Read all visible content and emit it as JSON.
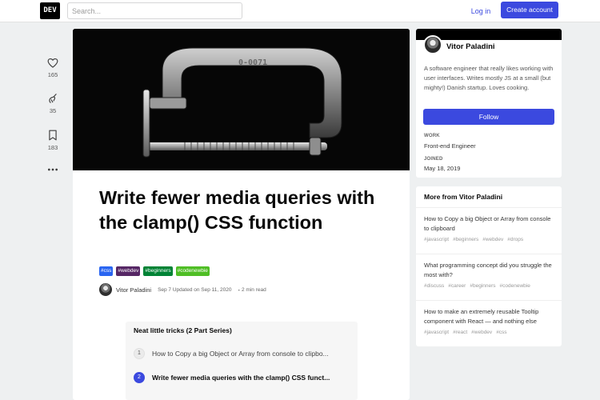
{
  "header": {
    "logo_text": "DEV",
    "search_placeholder": "Search...",
    "login_label": "Log in",
    "create_account_label": "Create account"
  },
  "reactions": [
    {
      "icon": "heart-icon",
      "count": "165"
    },
    {
      "icon": "unicorn-icon",
      "count": "35"
    },
    {
      "icon": "bookmark-icon",
      "count": "183"
    },
    {
      "icon": "more-options-icon",
      "count": ""
    }
  ],
  "article": {
    "cover_text": "0-0071",
    "title": "Write fewer media queries with the clamp() CSS function",
    "tags": [
      {
        "label": "#css",
        "color": "#2965f1"
      },
      {
        "label": "#webdev",
        "color": "#562765"
      },
      {
        "label": "#beginners",
        "color": "#008335"
      },
      {
        "label": "#codenewbie",
        "color": "#4fbe25"
      }
    ],
    "author": "Vitor Paladini",
    "date": "Sep 7 Updated on Sep 11, 2020",
    "separator": "・",
    "read_time": "2 min read"
  },
  "series": {
    "title": "Neat little tricks (2 Part Series)",
    "items": [
      {
        "num": "1",
        "label": "How to Copy a big Object or Array from console to clipbo..."
      },
      {
        "num": "2",
        "label": "Write fewer media queries with the clamp() CSS funct..."
      }
    ]
  },
  "profile": {
    "name": "Vitor Paladini",
    "bio": "A software engineer that really likes working with user interfaces. Writes mostly JS at a small (but mighty!) Danish startup. Loves cooking.",
    "follow_label": "Follow",
    "work_label": "WORK",
    "work_value": "Front-end Engineer",
    "joined_label": "JOINED",
    "joined_value": "May 18, 2019"
  },
  "more": {
    "heading": "More from Vitor Paladini",
    "items": [
      {
        "title": "How to Copy a big Object or Array from console to clipboard",
        "tags": [
          "#javascript",
          "#beginners",
          "#webdev",
          "#drops"
        ]
      },
      {
        "title": "What programming concept did you struggle the most with?",
        "tags": [
          "#discuss",
          "#career",
          "#beginners",
          "#codenewbie"
        ]
      },
      {
        "title": "How to make an extremely reusable Tooltip component with React — and nothing else",
        "tags": [
          "#javascript",
          "#react",
          "#webdev",
          "#css"
        ]
      }
    ]
  },
  "colors": {
    "accent": "#3b49df",
    "page_bg": "#eef0f1"
  }
}
